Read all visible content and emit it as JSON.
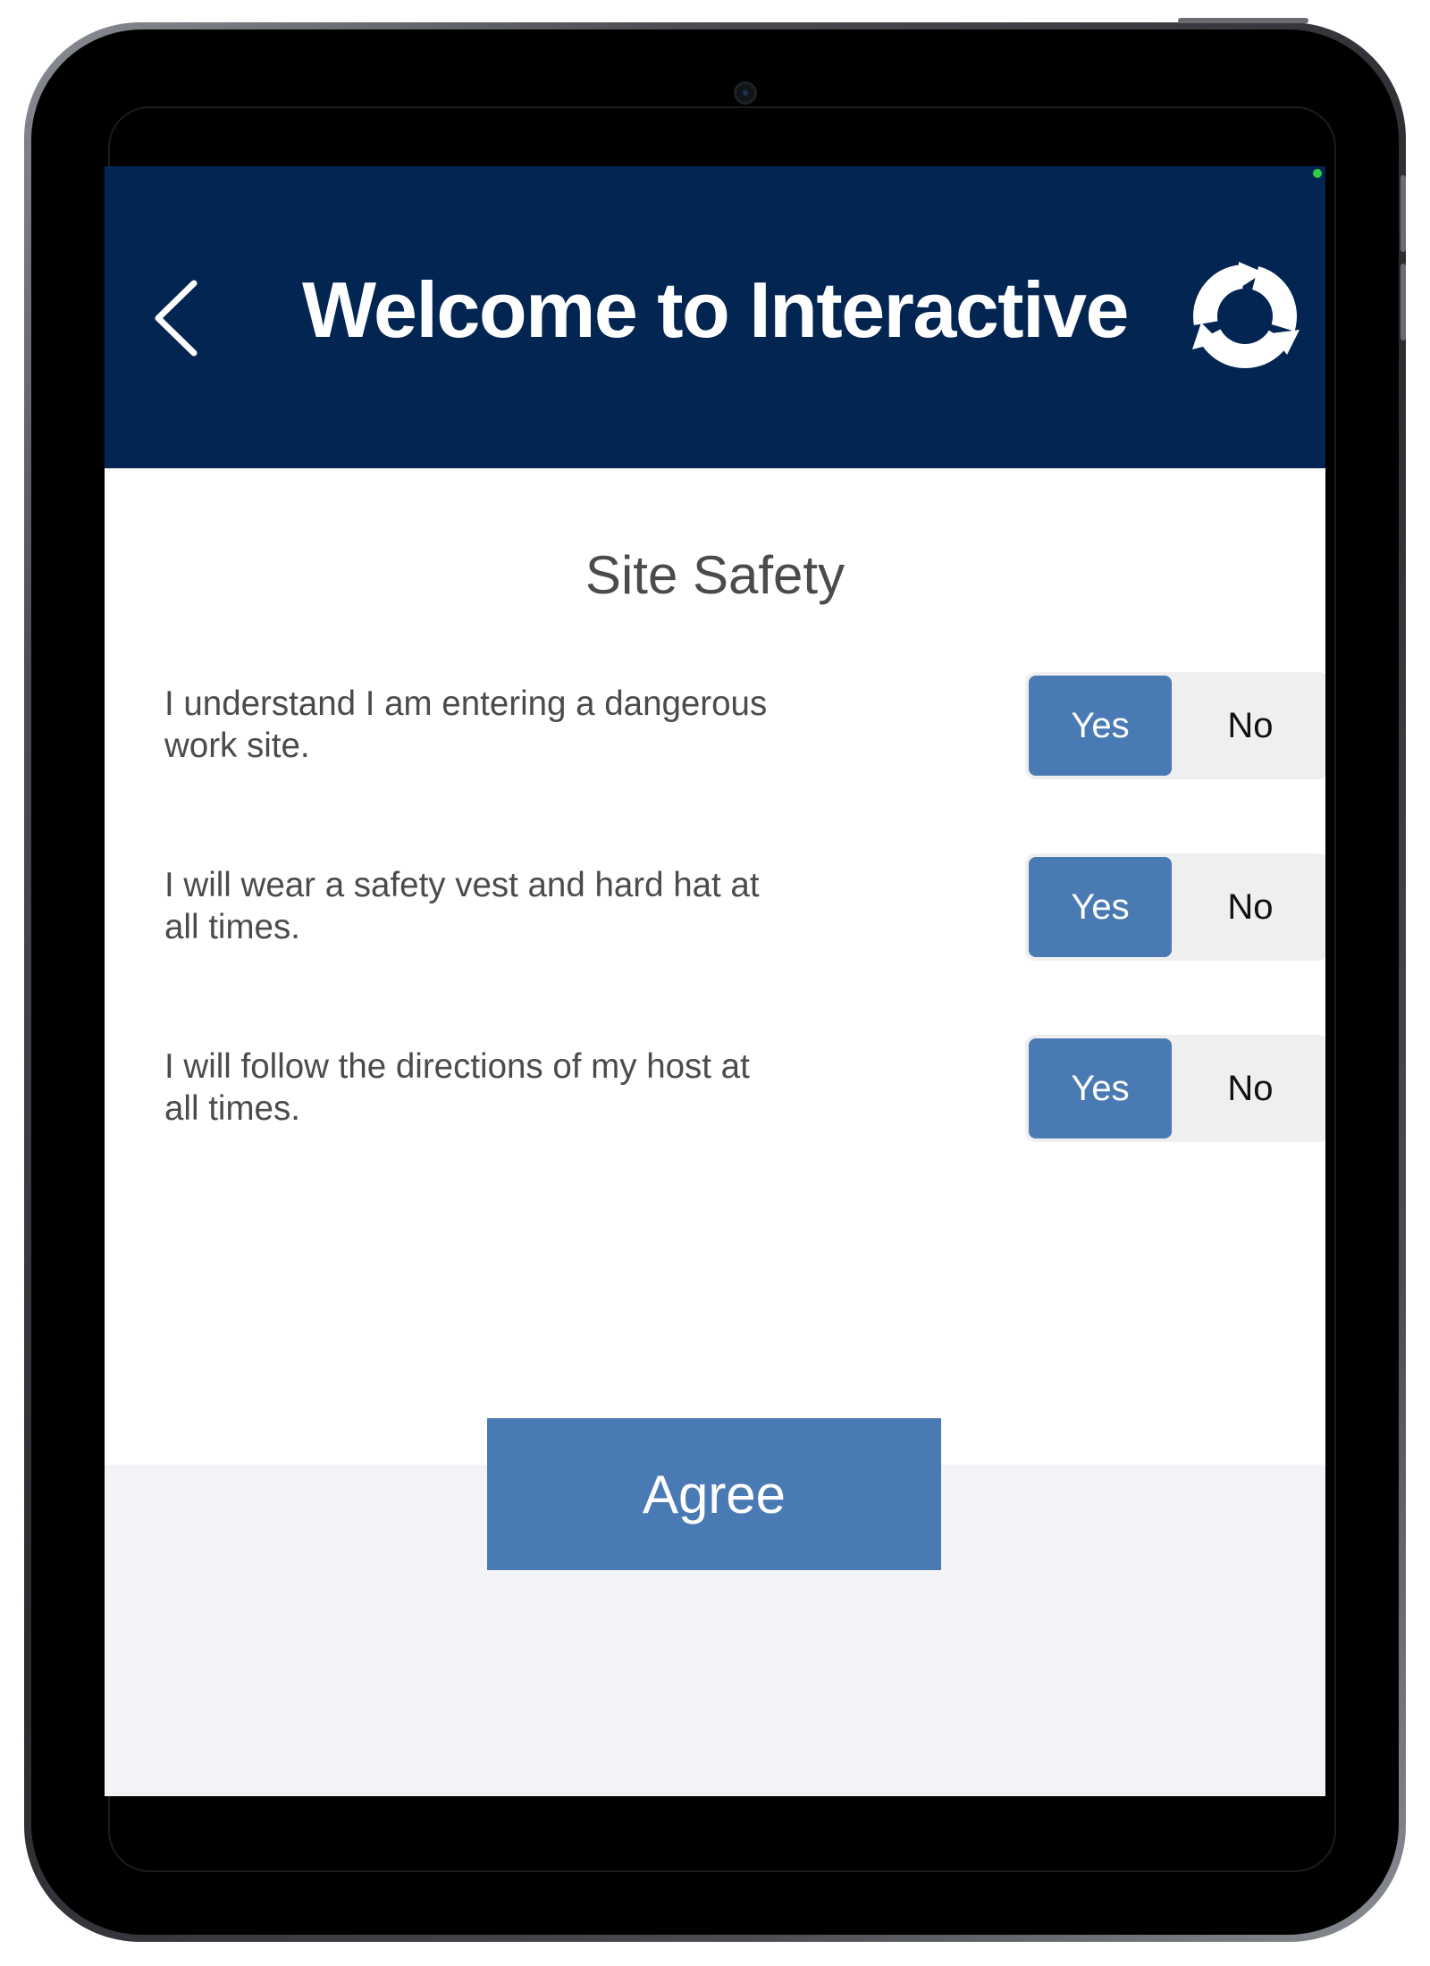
{
  "header": {
    "title": "Welcome to Interactive",
    "back_icon": "chevron-left-icon",
    "refresh_icon": "refresh-cycle-icon",
    "background_color": "#022552"
  },
  "section": {
    "title": "Site Safety"
  },
  "questions": [
    {
      "line1": "I understand I am entering a dangerous",
      "line2": "work site.",
      "yes_label": "Yes",
      "no_label": "No",
      "selected": "Yes"
    },
    {
      "line1": "I will wear a safety vest and hard hat at",
      "line2": "all times.",
      "yes_label": "Yes",
      "no_label": "No",
      "selected": "Yes"
    },
    {
      "line1": "I will follow the directions of my host at",
      "line2": "all times.",
      "yes_label": "Yes",
      "no_label": "No",
      "selected": "Yes"
    }
  ],
  "actions": {
    "agree_label": "Agree"
  },
  "colors": {
    "accent": "#4a7ab4",
    "segment_background": "#efeff0",
    "footer_background": "#f2f2f7",
    "status_indicator": "#2ecc40"
  }
}
